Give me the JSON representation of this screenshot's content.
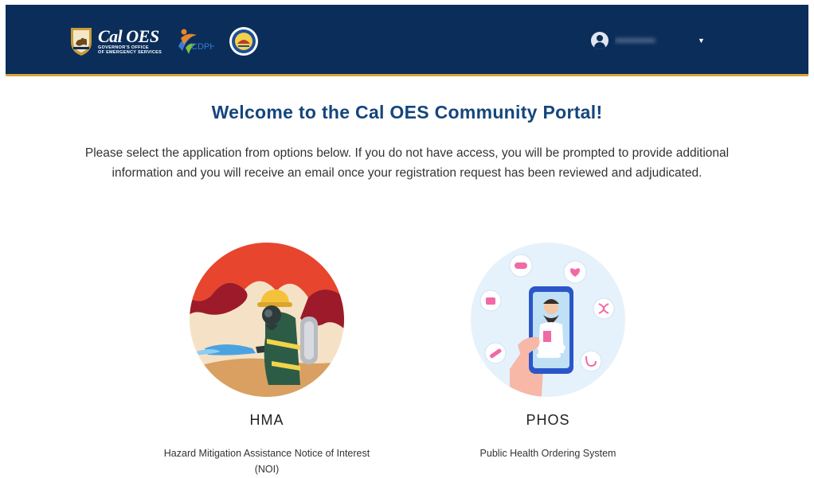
{
  "header": {
    "logo": {
      "name": "Cal OES",
      "sub_line1": "GOVERNOR'S OFFICE",
      "sub_line2": "OF EMERGENCY SERVICES"
    },
    "partner_logo": "CDPH",
    "user": {
      "name": "••••••••••••",
      "menu_icon": "chevron-down-icon"
    },
    "colors": {
      "background": "#0b2d5a",
      "accent": "#d9a53a"
    }
  },
  "main": {
    "title": "Welcome to the Cal OES Community Portal!",
    "intro": "Please select the application from options below. If you do not have access, you will be prompted to provide additional information and you will receive an email once your registration request has been reviewed and adjudicated.",
    "apps": [
      {
        "name": "HMA",
        "description": "Hazard Mitigation Assistance Notice of Interest (NOI)"
      },
      {
        "name": "PHOS",
        "description": "Public Health Ordering System"
      }
    ]
  }
}
